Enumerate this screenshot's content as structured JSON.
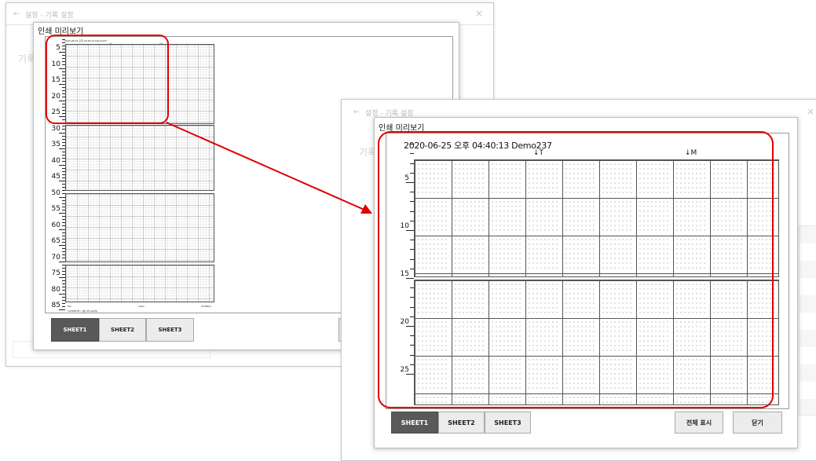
{
  "background_window": {
    "title": "설정 - 기록 설정",
    "close_glyph": "×",
    "faded_label": "기록"
  },
  "preview_dialog": {
    "title": "인쇄 미리보기",
    "header_text": "2020-06-25 오후 04:40:13 Demo237",
    "marker_t": "↓T",
    "marker_m": "↓M",
    "footer_left": "0m",
    "footer_mid": "1/2m",
    "footer_right": "2m/Mom",
    "footer_line": "12345678 / 1분 (03 sp/M)",
    "ruler_labels_small": [
      "5",
      "10",
      "15",
      "20",
      "25",
      "30",
      "35",
      "40",
      "45",
      "50",
      "55",
      "60",
      "65",
      "70",
      "75",
      "80",
      "85"
    ],
    "ruler_labels_zoom": [
      "5",
      "10",
      "15",
      "20",
      "25"
    ],
    "tabs": [
      "SHEET1",
      "SHEET2",
      "SHEET3"
    ],
    "active_tab": "SHEET1",
    "show_all_button": "전체 표시",
    "close_button": "닫기"
  },
  "annotation": {
    "highlight_color": "#e00000"
  }
}
